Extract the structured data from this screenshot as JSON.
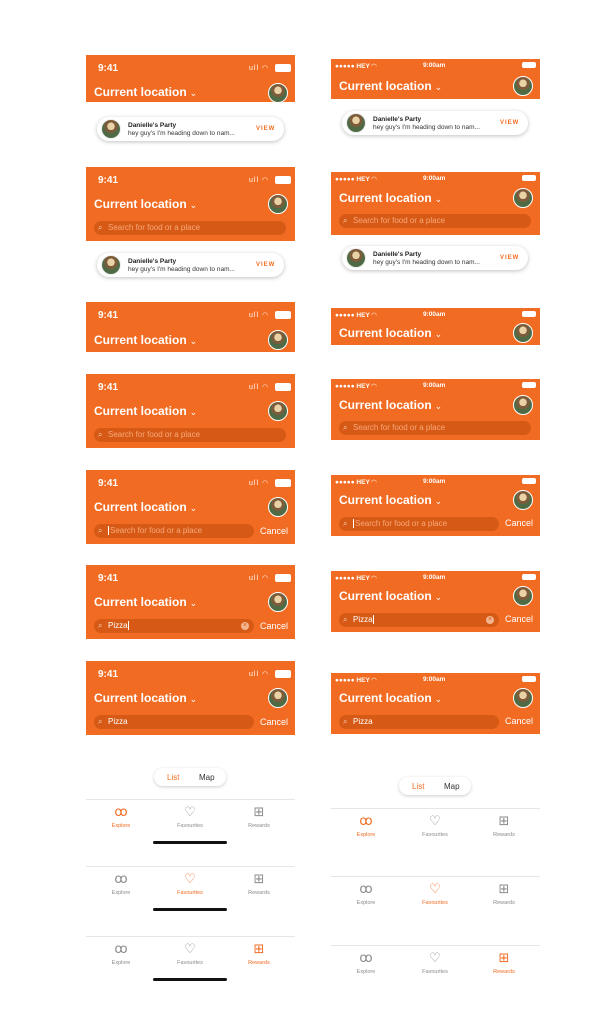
{
  "status": {
    "time_ios": "9:41",
    "signal_icons": "ull ◠",
    "carrier": "●●●●● HEY ◠",
    "time_alt": "9:00am"
  },
  "header": {
    "location": "Current location",
    "chevron": "⌄"
  },
  "search": {
    "placeholder": "Search for food or a place",
    "query": "Pizza",
    "cancel": "Cancel",
    "icon": "⌕",
    "clear": "×"
  },
  "notification": {
    "title": "Danielle's Party",
    "message": "hey guy's I'm heading down to nam...",
    "action": "VIEW"
  },
  "segmented": {
    "list": "List",
    "map": "Map"
  },
  "tabs": {
    "explore": "Explore",
    "favourites": "Favourites",
    "rewards": "Rewards",
    "explore_icon": "binoculars-icon",
    "favourites_icon": "heart-icon",
    "rewards_icon": "gift-icon"
  },
  "colors": {
    "accent": "#f26b22",
    "search_bg": "#d65a15"
  }
}
